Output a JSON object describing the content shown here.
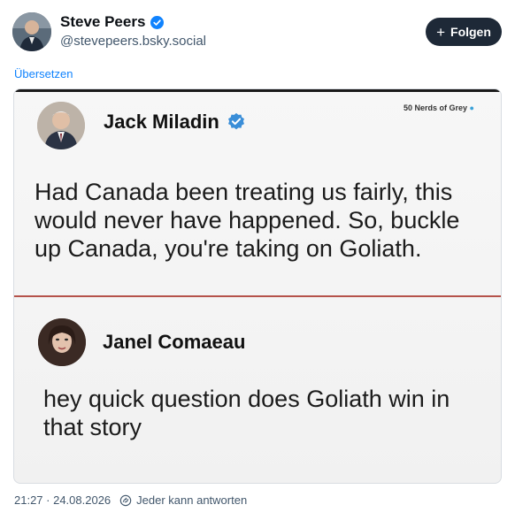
{
  "post": {
    "author_name": "Steve Peers",
    "author_handle": "@stevepeers.bsky.social",
    "follow_label": "Folgen",
    "translate_label": "Übersetzen",
    "timestamp": "21:27 · 24.08.2026",
    "reply_setting": "Jeder kann antworten"
  },
  "image": {
    "watermark": "50 Nerds of Grey",
    "tweet1": {
      "name": "Jack Miladin",
      "text": "Had Canada been treating us fairly, this would never have happened. So, buckle up Canada, you're taking on Goliath."
    },
    "tweet2": {
      "name": "Janel Comaeau",
      "text": "hey quick question does Goliath win in that story"
    }
  },
  "colors": {
    "link": "#1083fe",
    "follow_button": "#1e2937",
    "verified": "#1083fe",
    "divider": "#b5524a"
  },
  "icons": {
    "verified": "verified-check-icon",
    "follow": "plus-icon",
    "reply_setting": "globe-icon"
  }
}
